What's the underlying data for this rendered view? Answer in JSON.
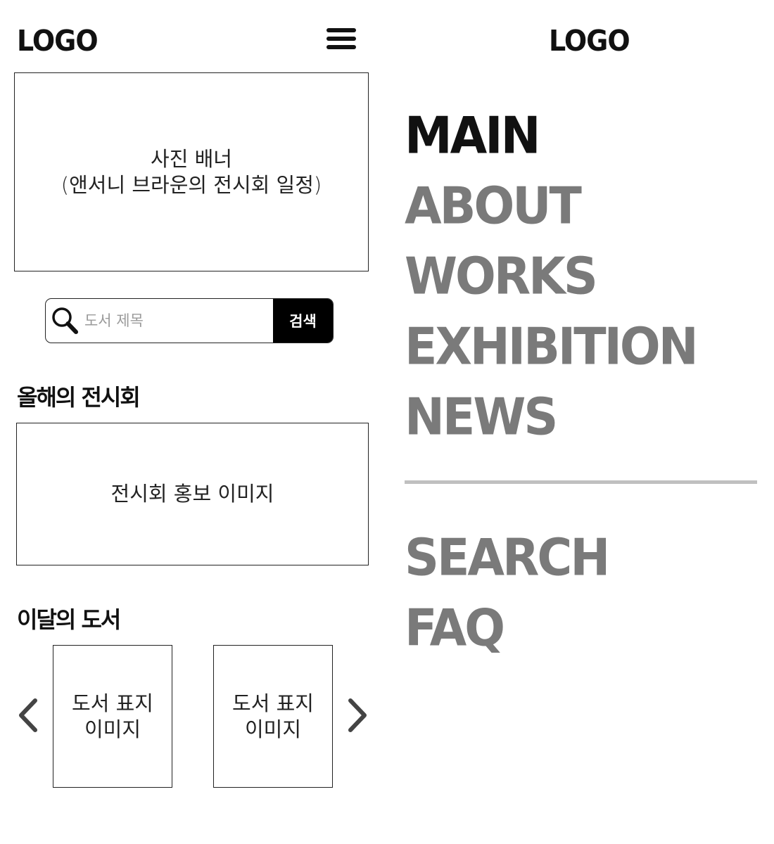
{
  "mobile_main": {
    "logo": "LOGO",
    "banner_text": "사진 배너\n(앤서니 브라운의 전시회 일정)",
    "search": {
      "placeholder": "도서 제목",
      "button_label": "검색"
    },
    "exhibition_section": {
      "title": "올해의 전시회",
      "image_text": "전시회 홍보 이미지"
    },
    "books_section": {
      "title": "이달의 도서",
      "books": [
        {
          "image_text": "도서 표지\n이미지"
        },
        {
          "image_text": "도서 표지\n이미지"
        }
      ]
    }
  },
  "menu_panel": {
    "logo": "LOGO",
    "primary_items": [
      "MAIN",
      "ABOUT",
      "WORKS",
      "EXHIBITION",
      "NEWS"
    ],
    "secondary_items": [
      "SEARCH",
      "FAQ"
    ],
    "active_item": "MAIN"
  },
  "icons": {
    "menu": "hamburger-menu-icon",
    "search": "magnifier-icon",
    "prev": "chevron-left-icon",
    "next": "chevron-right-icon"
  },
  "colors": {
    "active_nav": "#111111",
    "inactive_nav": "#7a7a7a",
    "search_button_bg": "#000000",
    "divider": "#c0c0c0"
  }
}
